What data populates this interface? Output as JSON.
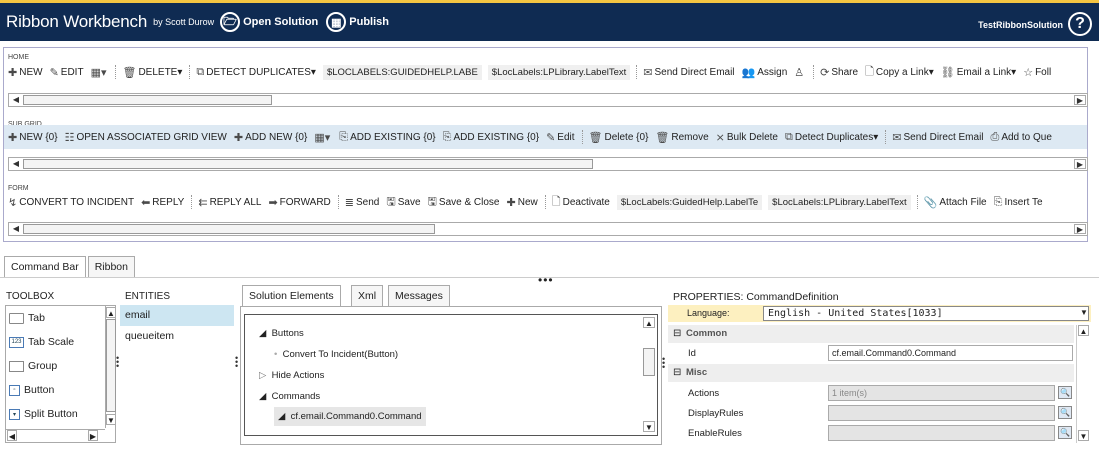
{
  "header": {
    "title": "Ribbon Workbench",
    "byline": "by Scott Durow",
    "open_solution": "Open Solution",
    "publish": "Publish",
    "solution_name": "TestRibbonSolution",
    "help": "?"
  },
  "home": {
    "label": "HOME",
    "items": [
      "NEW",
      "EDIT",
      "",
      "DELETE",
      "DETECT DUPLICATES",
      "$LOCLABELS:GUIDEDHELP.LABE",
      "$LocLabels:LPLibrary.LabelText",
      "Send Direct Email",
      "Assign",
      "",
      "Share",
      "Copy a Link",
      "Email a Link",
      "Foll"
    ]
  },
  "subgrid": {
    "label": "SUB GRID",
    "items": [
      "NEW {0}",
      "OPEN ASSOCIATED GRID VIEW",
      "ADD NEW {0}",
      "",
      "ADD EXISTING {0}",
      "ADD EXISTING {0}",
      "Edit",
      "Delete {0}",
      "Remove",
      "Bulk Delete",
      "Detect Duplicates",
      "Send Direct Email",
      "Add to Que"
    ]
  },
  "form": {
    "label": "FORM",
    "items": [
      "CONVERT TO INCIDENT",
      "REPLY",
      "REPLY ALL",
      "FORWARD",
      "Send",
      "Save",
      "Save & Close",
      "New",
      "Deactivate",
      "$LocLabels:GuidedHelp.LabelTe",
      "$LocLabels:LPLibrary.LabelText",
      "Attach File",
      "Insert Te"
    ]
  },
  "tabs": {
    "command_bar": "Command Bar",
    "ribbon": "Ribbon"
  },
  "toolbox": {
    "heading": "TOOLBOX",
    "items": [
      "Tab",
      "Tab Scale",
      "Group",
      "Button",
      "Split Button"
    ]
  },
  "entities": {
    "heading": "ENTITIES",
    "items": [
      "email",
      "queueitem"
    ]
  },
  "solution": {
    "tabs": [
      "Solution Elements",
      "Xml",
      "Messages"
    ],
    "tree": [
      "Buttons",
      "Convert To Incident(Button)",
      "Hide Actions",
      "Commands",
      "cf.email.Command0.Command"
    ]
  },
  "properties": {
    "heading": "PROPERTIES: CommandDefinition",
    "language_label": "Language:",
    "language_value": "English - United States[1033]",
    "common": "Common",
    "id_label": "Id",
    "id_value": "cf.email.Command0.Command",
    "misc": "Misc",
    "actions_label": "Actions",
    "actions_value": "1 item(s)",
    "displayrules_label": "DisplayRules",
    "enablerules_label": "EnableRules"
  }
}
